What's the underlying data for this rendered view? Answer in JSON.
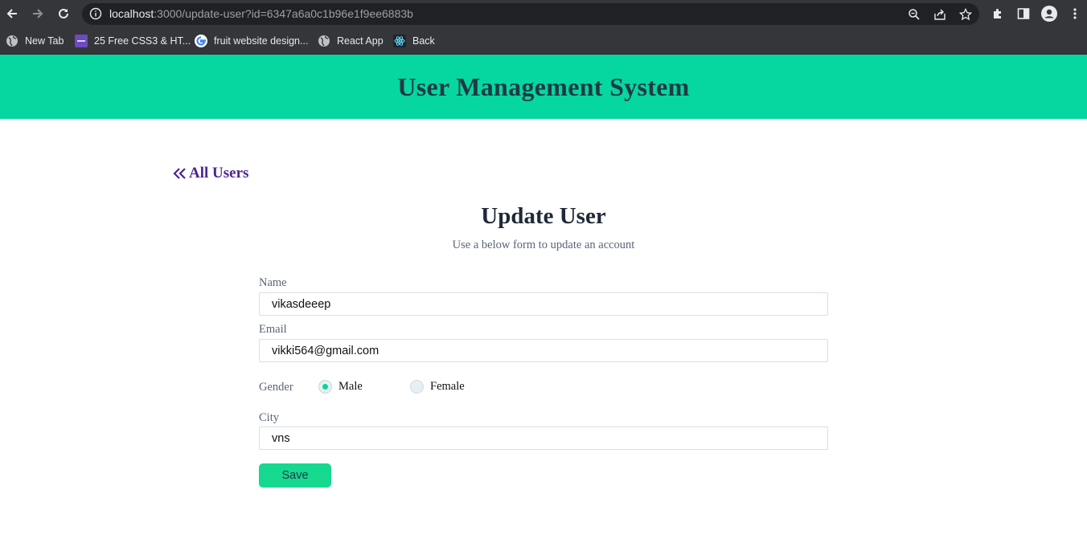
{
  "browser": {
    "url_host": "localhost",
    "url_rest": ":3000/update-user?id=6347a6a0c1b96e1f9ee6883b",
    "bookmarks": [
      {
        "label": "New Tab",
        "icon": "globe-icon"
      },
      {
        "label": "25 Free CSS3 & HT...",
        "icon": "colorlib-icon"
      },
      {
        "label": "fruit website design...",
        "icon": "google-icon"
      },
      {
        "label": "React App",
        "icon": "globe-icon"
      },
      {
        "label": "Back",
        "icon": "react-icon"
      }
    ]
  },
  "app": {
    "title": "User Management System",
    "accent_color": "#06d6a0"
  },
  "nav": {
    "back_label": "All Users"
  },
  "form": {
    "title": "Update User",
    "subtitle": "Use a below form to update an account",
    "name_label": "Name",
    "name_value": "vikasdeeep",
    "email_label": "Email",
    "email_value": "vikki564@gmail.com",
    "gender_label": "Gender",
    "gender_options": [
      {
        "label": "Male",
        "checked": true
      },
      {
        "label": "Female",
        "checked": false
      }
    ],
    "city_label": "City",
    "city_value": "vns",
    "save_label": "Save"
  }
}
